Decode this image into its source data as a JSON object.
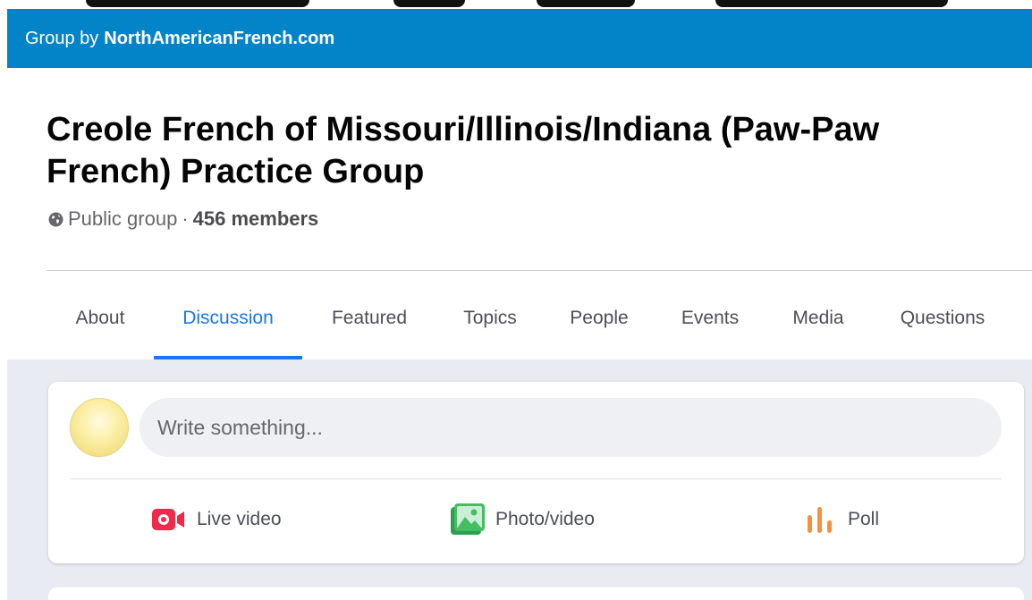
{
  "banner": {
    "prefix": "Group by",
    "site": "NorthAmericanFrench.com",
    "color": "#0384c9"
  },
  "group": {
    "title": "Creole French of Missouri/Illinois/Indiana (Paw-Paw French) Practice Group",
    "privacy_icon": "globe-icon",
    "privacy": "Public group",
    "separator": "·",
    "members": "456 members"
  },
  "tabs": [
    {
      "label": "About",
      "active": false
    },
    {
      "label": "Discussion",
      "active": true
    },
    {
      "label": "Featured",
      "active": false
    },
    {
      "label": "Topics",
      "active": false
    },
    {
      "label": "People",
      "active": false
    },
    {
      "label": "Events",
      "active": false
    },
    {
      "label": "Media",
      "active": false
    },
    {
      "label": "Questions",
      "active": false
    }
  ],
  "composer": {
    "placeholder": "Write something...",
    "actions": [
      {
        "label": "Live video",
        "icon": "live-video-icon",
        "color": "#f02849"
      },
      {
        "label": "Photo/video",
        "icon": "photo-video-icon",
        "color": "#45bd62"
      },
      {
        "label": "Poll",
        "icon": "poll-icon",
        "color": "#f7923b"
      }
    ]
  },
  "colors": {
    "accent": "#1877f2",
    "feed_background": "#e8ecf2"
  }
}
